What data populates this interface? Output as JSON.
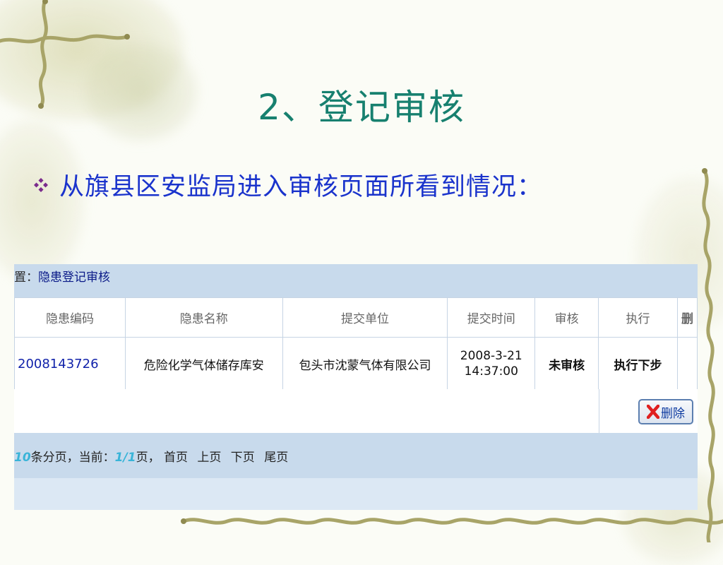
{
  "slide": {
    "title": "2、登记审核",
    "bullet": "从旗县区安监局进入审核页面所看到情况："
  },
  "screenshot": {
    "breadcrumb_prefix": "置：",
    "breadcrumb_current": "隐患登记审核",
    "table": {
      "headers": [
        "隐患编码",
        "隐患名称",
        "提交单位",
        "提交时间",
        "审核",
        "执行",
        "删"
      ],
      "rows": [
        {
          "code": "2008143726",
          "name": "危险化学气体储存库安",
          "unit": "包头市沈蒙气体有限公司",
          "time_date": "2008-3-21",
          "time_clock": "14:37:00",
          "review": "未审核",
          "execute": "执行下步"
        }
      ]
    },
    "delete_button": "删除",
    "pager": {
      "per_page": "10",
      "per_page_suffix": "条分页，当前：",
      "current": "1",
      "separator": "/",
      "total": "1",
      "page_suffix": "页，",
      "links": [
        "首页",
        "上页",
        "下页",
        "尾页"
      ]
    }
  },
  "colors": {
    "title": "#17806f",
    "bullet_text": "#1a33cc",
    "header_bar": "#c8daec",
    "status_red": "#d00000"
  },
  "icons": {
    "bullet": "diamond-bullet-icon",
    "delete": "red-x-icon"
  }
}
